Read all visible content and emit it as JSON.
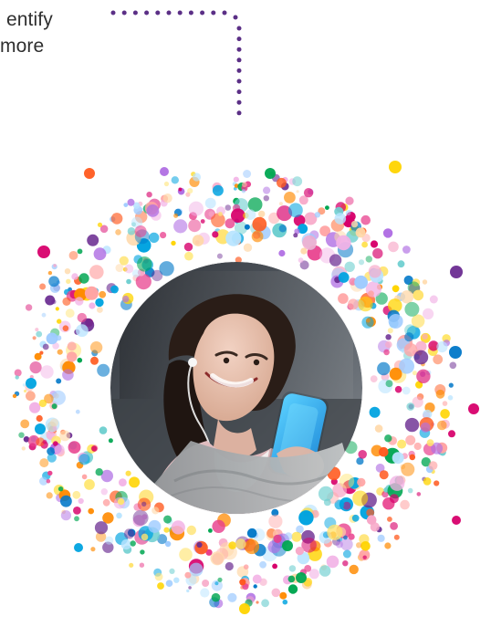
{
  "text": {
    "line1": "entify",
    "line2": "more"
  },
  "palette": [
    "#d7006b",
    "#ff5a1f",
    "#ff8a00",
    "#ffd400",
    "#6b2c91",
    "#0077c8",
    "#00a3e0",
    "#00a651",
    "#e83e8c",
    "#b06fe3",
    "#f7a8c8",
    "#f2b1e5",
    "#ffd8a8",
    "#ffe36e",
    "#9ecbff",
    "#6fcfd0",
    "#b9e4ff",
    "#ffa4a4"
  ]
}
